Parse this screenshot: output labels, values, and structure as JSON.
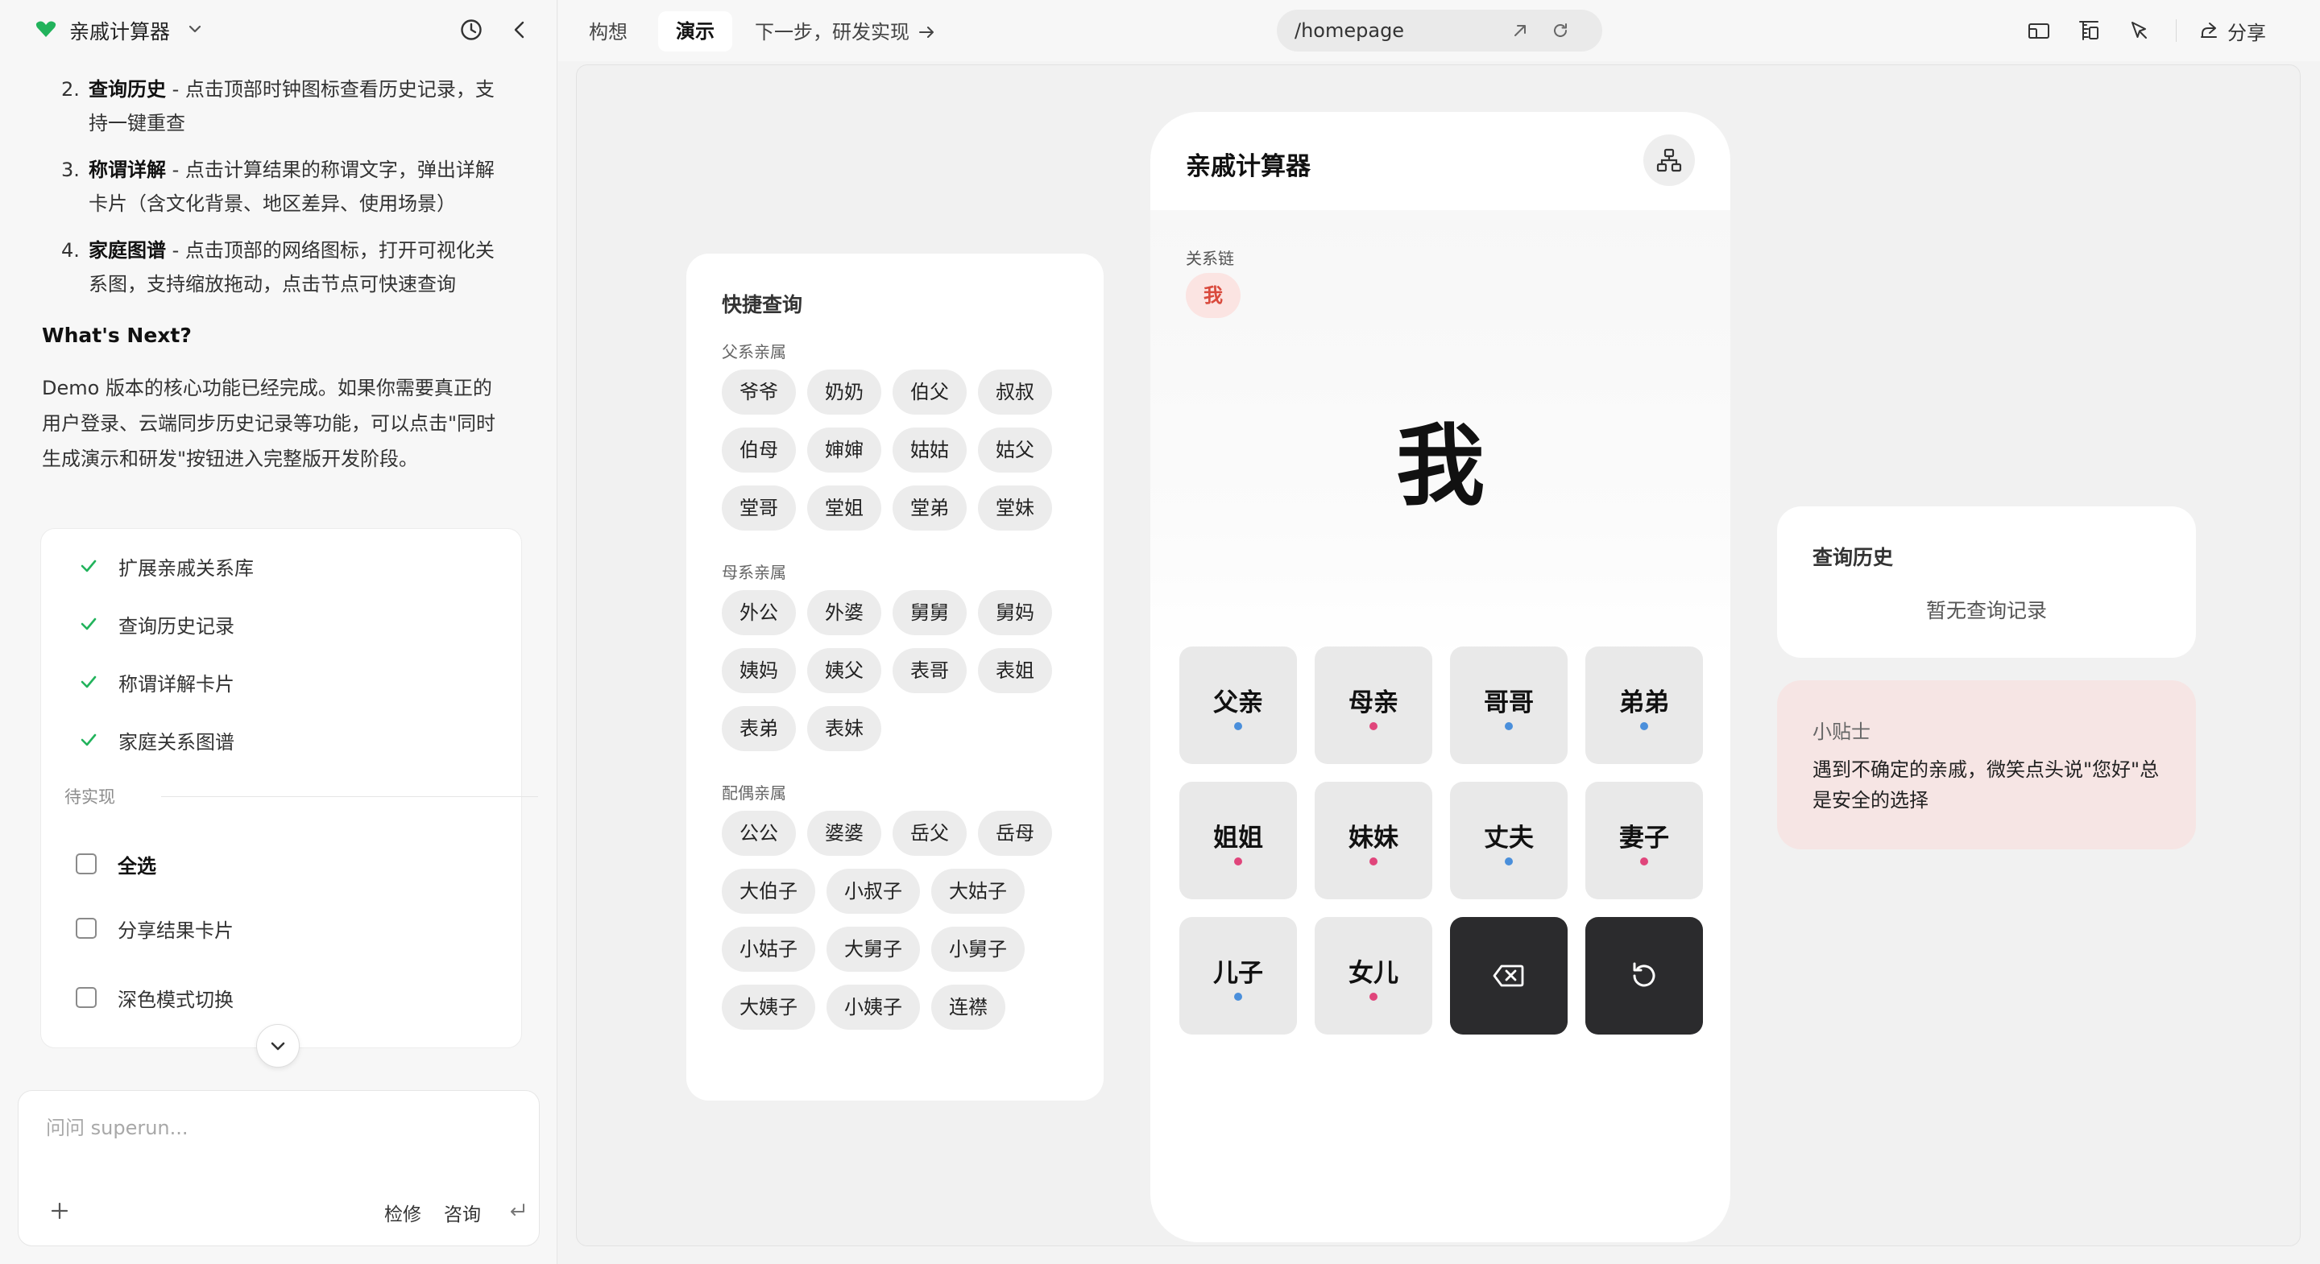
{
  "project": {
    "title": "亲戚计算器"
  },
  "guide": {
    "items": [
      {
        "num": "2.",
        "title": "查询历史",
        "desc": " - 点击顶部时钟图标查看历史记录，支持一键重查"
      },
      {
        "num": "3.",
        "title": "称谓详解",
        "desc": " - 点击计算结果的称谓文字，弹出详解卡片（含文化背景、地区差异、使用场景）"
      },
      {
        "num": "4.",
        "title": "家庭图谱",
        "desc": " - 点击顶部的网络图标，打开可视化关系图，支持缩放拖动，点击节点可快速查询"
      }
    ],
    "whats_next": "What's Next?",
    "next_paragraph": "Demo 版本的核心功能已经完成。如果你需要真正的用户登录、云端同步历史记录等功能，可以点击\"同时生成演示和研发\"按钮进入完整版开发阶段。"
  },
  "todo": {
    "done": [
      "扩展亲戚关系库",
      "查询历史记录",
      "称谓详解卡片",
      "家庭关系图谱"
    ],
    "pending_label": "待实现",
    "select_all": "全选",
    "pending": [
      "分享结果卡片",
      "深色模式切换"
    ]
  },
  "chat": {
    "placeholder": "问问 superun...",
    "repair": "检修",
    "consult": "咨询"
  },
  "topbar": {
    "tabs": {
      "concept": "构想",
      "demo": "演示",
      "next": "下一步，研发实现"
    },
    "url": "/homepage",
    "share": "分享"
  },
  "quick": {
    "title": "快捷查询",
    "groups": [
      {
        "label": "父系亲属",
        "chips": [
          "爷爷",
          "奶奶",
          "伯父",
          "叔叔",
          "伯母",
          "婶婶",
          "姑姑",
          "姑父",
          "堂哥",
          "堂姐",
          "堂弟",
          "堂妹"
        ]
      },
      {
        "label": "母系亲属",
        "chips": [
          "外公",
          "外婆",
          "舅舅",
          "舅妈",
          "姨妈",
          "姨父",
          "表哥",
          "表姐",
          "表弟",
          "表妹"
        ]
      },
      {
        "label": "配偶亲属",
        "chips": [
          "公公",
          "婆婆",
          "岳父",
          "岳母",
          "大伯子",
          "小叔子",
          "大姑子",
          "小姑子",
          "大舅子",
          "小舅子",
          "大姨子",
          "小姨子",
          "连襟"
        ]
      }
    ]
  },
  "phone": {
    "title": "亲戚计算器",
    "chain_label": "关系链",
    "chain_me": "我",
    "result": "我",
    "keys": [
      {
        "label": "父亲",
        "gender": "male"
      },
      {
        "label": "母亲",
        "gender": "female"
      },
      {
        "label": "哥哥",
        "gender": "male"
      },
      {
        "label": "弟弟",
        "gender": "male"
      },
      {
        "label": "姐姐",
        "gender": "female"
      },
      {
        "label": "妹妹",
        "gender": "female"
      },
      {
        "label": "丈夫",
        "gender": "male"
      },
      {
        "label": "妻子",
        "gender": "female"
      },
      {
        "label": "儿子",
        "gender": "male"
      },
      {
        "label": "女儿",
        "gender": "female"
      }
    ],
    "colors": {
      "male": "#4a8fdb",
      "female": "#e0457b"
    }
  },
  "history": {
    "title": "查询历史",
    "empty": "暂无查询记录"
  },
  "tip": {
    "title": "小贴士",
    "text": "遇到不确定的亲戚，微笑点头说\"您好\"总是安全的选择"
  }
}
